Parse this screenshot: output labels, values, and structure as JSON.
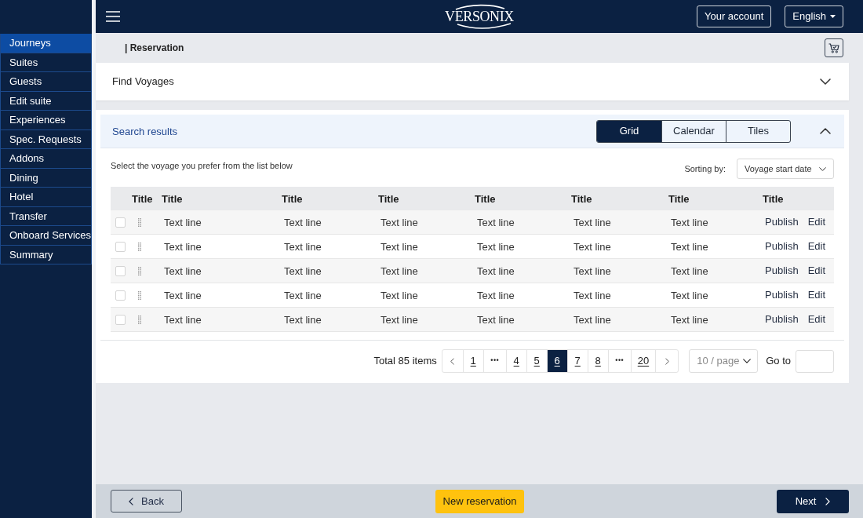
{
  "header": {
    "logo": "VERSONIX",
    "account_button": "Your account",
    "language_button": "English"
  },
  "sidebar": {
    "items": [
      {
        "label": "Journeys",
        "selected": true
      },
      {
        "label": "Suites",
        "selected": false
      },
      {
        "label": "Guests",
        "selected": false
      },
      {
        "label": "Edit suite",
        "selected": false
      },
      {
        "label": "Experiences",
        "selected": false
      },
      {
        "label": "Spec. Requests",
        "selected": false
      },
      {
        "label": "Addons",
        "selected": false
      },
      {
        "label": "Dining",
        "selected": false
      },
      {
        "label": "Hotel",
        "selected": false
      },
      {
        "label": "Transfer",
        "selected": false
      },
      {
        "label": "Onboard Services",
        "selected": false
      },
      {
        "label": "Summary",
        "selected": false
      }
    ]
  },
  "breadcrumb": "| Reservation",
  "find_panel": {
    "title": "Find Voyages",
    "expanded": false
  },
  "results_panel": {
    "title": "Search results",
    "expanded": true,
    "view_tabs": [
      {
        "label": "Grid",
        "selected": true
      },
      {
        "label": "Calendar",
        "selected": false
      },
      {
        "label": "Tiles",
        "selected": false
      }
    ],
    "instruction": "Select the voyage you prefer from the list below",
    "sorting": {
      "label": "Sorting by:",
      "value": "Voyage start date"
    },
    "table": {
      "columns": [
        "Title",
        "Title",
        "Title",
        "Title",
        "Title",
        "Title",
        "Title",
        "Title"
      ],
      "rows": [
        {
          "checked": false,
          "cells": [
            "",
            "Text line",
            "Text line",
            "Text line",
            "Text line",
            "Text line",
            "Text line"
          ],
          "actions": [
            "Publish",
            "Edit"
          ]
        },
        {
          "checked": false,
          "cells": [
            "",
            "Text line",
            "Text line",
            "Text line",
            "Text line",
            "Text line",
            "Text line"
          ],
          "actions": [
            "Publish",
            "Edit"
          ]
        },
        {
          "checked": false,
          "cells": [
            "",
            "Text line",
            "Text line",
            "Text line",
            "Text line",
            "Text line",
            "Text line"
          ],
          "actions": [
            "Publish",
            "Edit"
          ]
        },
        {
          "checked": false,
          "cells": [
            "",
            "Text line",
            "Text line",
            "Text line",
            "Text line",
            "Text line",
            "Text line"
          ],
          "actions": [
            "Publish",
            "Edit"
          ]
        },
        {
          "checked": false,
          "cells": [
            "",
            "Text line",
            "Text line",
            "Text line",
            "Text line",
            "Text line",
            "Text line"
          ],
          "actions": [
            "Publish",
            "Edit"
          ]
        }
      ]
    },
    "pagination": {
      "total": "Total 85 items",
      "pages": [
        {
          "label": "1",
          "kind": "page",
          "selected": false
        },
        {
          "label": "•••",
          "kind": "ellipsis",
          "selected": false
        },
        {
          "label": "4",
          "kind": "page",
          "selected": false
        },
        {
          "label": "5",
          "kind": "page",
          "selected": false
        },
        {
          "label": "6",
          "kind": "page",
          "selected": true
        },
        {
          "label": "7",
          "kind": "page",
          "selected": false
        },
        {
          "label": "8",
          "kind": "page",
          "selected": false
        },
        {
          "label": "•••",
          "kind": "ellipsis",
          "selected": false
        },
        {
          "label": "20",
          "kind": "page",
          "selected": false
        }
      ],
      "page_size": "10 / page",
      "goto_label": "Go to"
    }
  },
  "footer": {
    "back_button": "Back",
    "new_reservation_button": "New reservation",
    "next_button": "Next"
  }
}
